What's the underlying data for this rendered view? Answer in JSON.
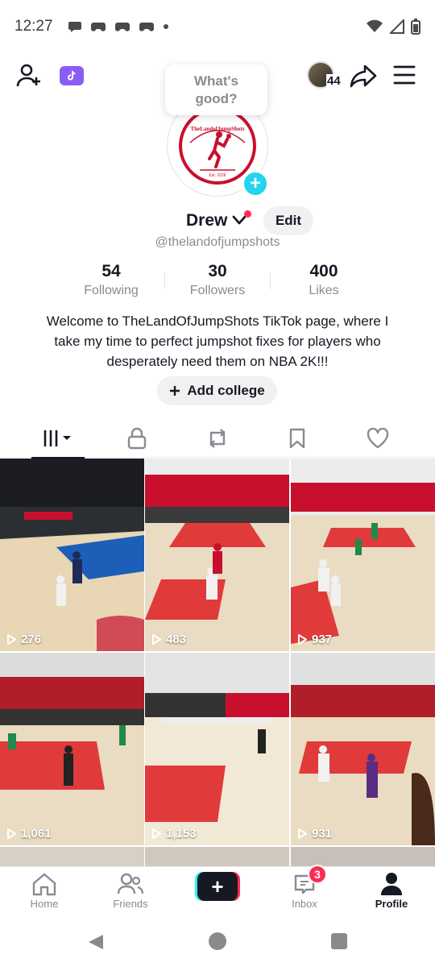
{
  "status_bar": {
    "time": "12:27"
  },
  "top_bar": {
    "visitor_count": "44"
  },
  "bubble": {
    "text": "What's good?"
  },
  "logo": {
    "text": "TheLandofJumpShots",
    "est": "Est. 2026"
  },
  "profile": {
    "name": "Drew",
    "handle": "@thelandofjumpshots",
    "edit_label": "Edit",
    "bio": "Welcome to TheLandOfJumpShots TikTok page, where I take my time to perfect jumpshot fixes for players who desperately need them on NBA 2K!!!",
    "add_college_label": "Add college"
  },
  "stats": [
    {
      "value": "54",
      "label": "Following"
    },
    {
      "value": "30",
      "label": "Followers"
    },
    {
      "value": "400",
      "label": "Likes"
    }
  ],
  "videos": [
    {
      "views": "276"
    },
    {
      "views": "483"
    },
    {
      "views": "937"
    },
    {
      "views": "1,061"
    },
    {
      "views": "1,153"
    },
    {
      "views": "931"
    }
  ],
  "bottom_nav": {
    "home": "Home",
    "friends": "Friends",
    "inbox": "Inbox",
    "inbox_badge": "3",
    "profile": "Profile"
  },
  "colors": {
    "accent_red": "#fe2c55",
    "accent_cyan": "#25f4ee",
    "pro_purple": "#8b5cf6"
  }
}
